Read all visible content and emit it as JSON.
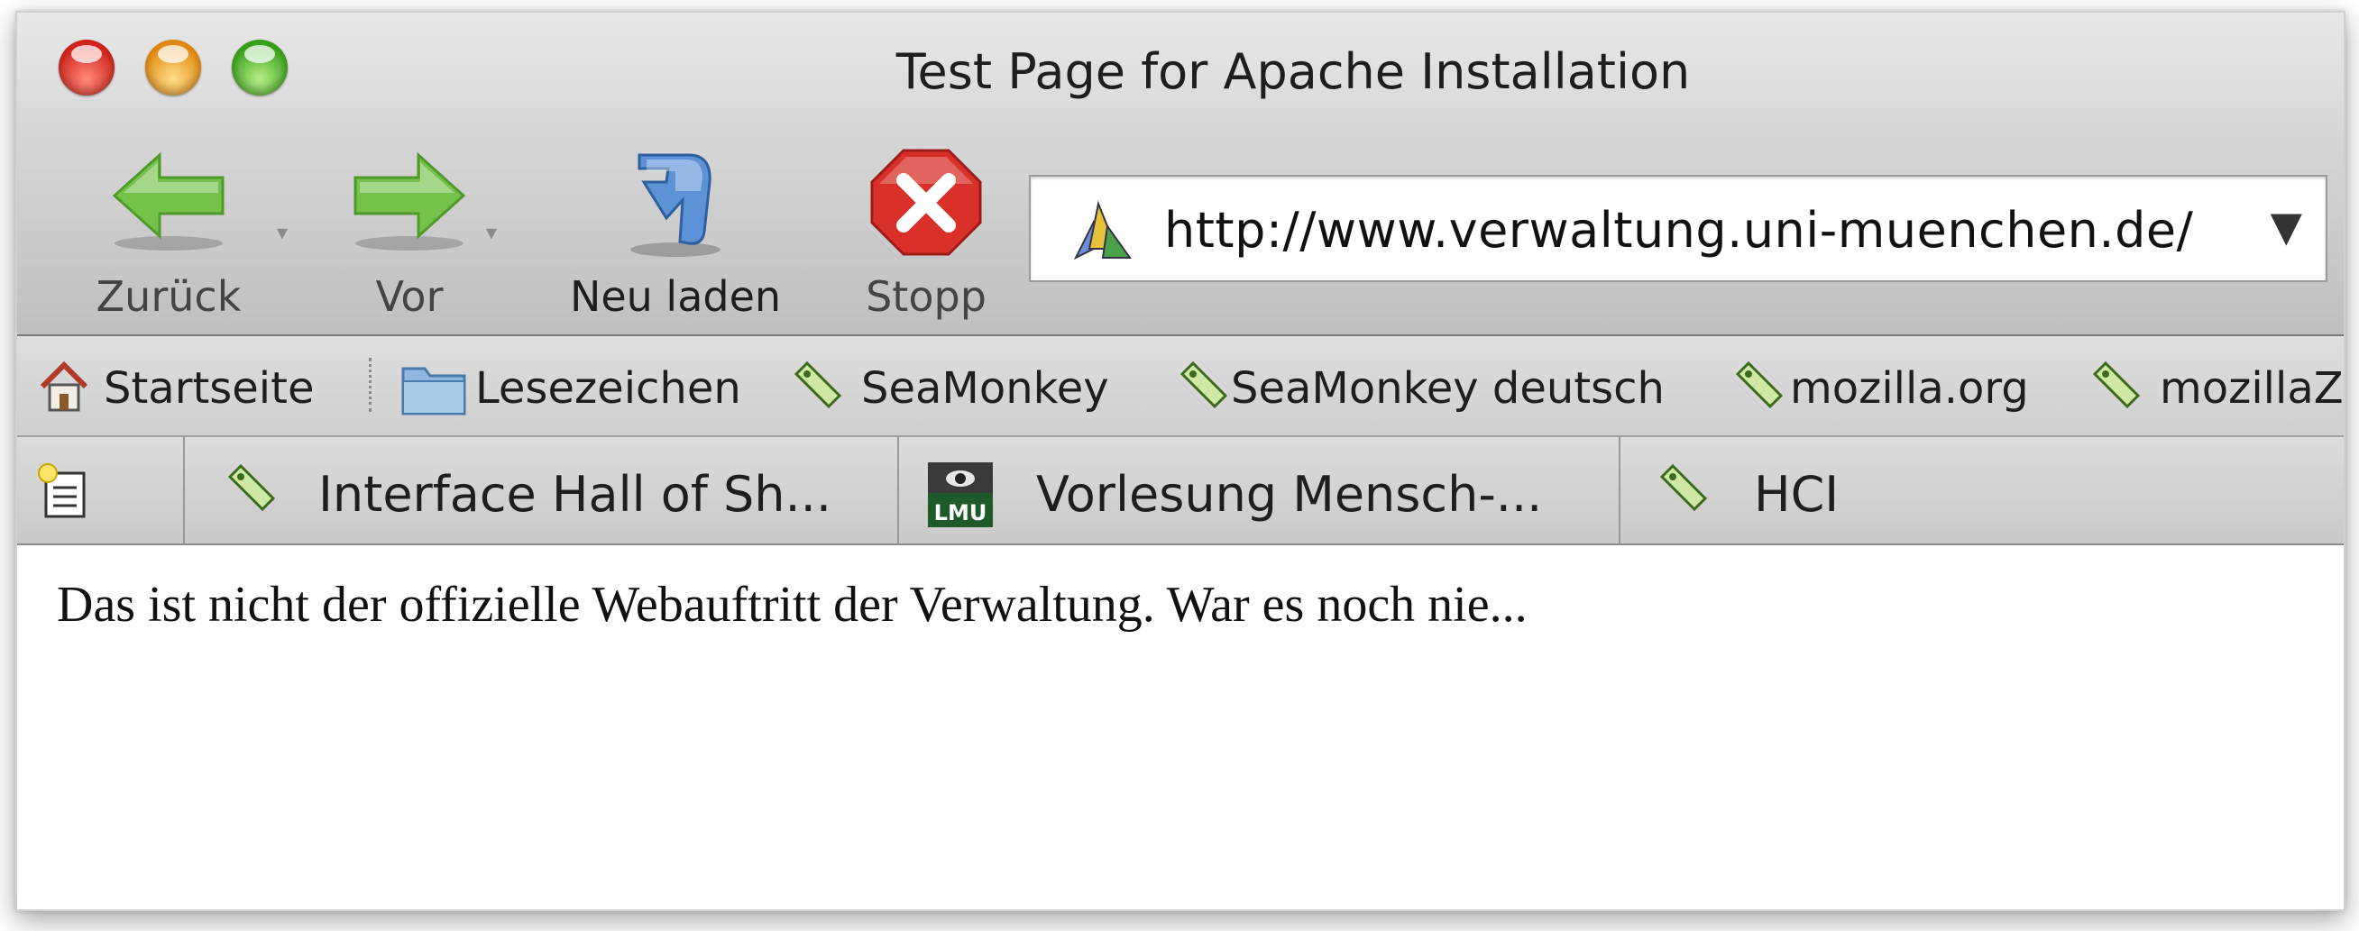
{
  "window": {
    "title": "Test Page for Apache Installation"
  },
  "toolbar": {
    "back_label": "Zurück",
    "forward_label": "Vor",
    "reload_label": "Neu laden",
    "stop_label": "Stopp"
  },
  "urlbar": {
    "url": "http://www.verwaltung.uni-muenchen.de/"
  },
  "bookmarks": {
    "items": [
      {
        "label": "Startseite",
        "icon": "home-icon"
      },
      {
        "label": "Lesezeichen",
        "icon": "folder-icon"
      },
      {
        "label": "SeaMonkey",
        "icon": "bookmark-icon"
      },
      {
        "label": "SeaMonkey deutsch",
        "icon": "bookmark-icon"
      },
      {
        "label": "mozilla.org",
        "icon": "bookmark-icon"
      },
      {
        "label": "mozillaZ",
        "icon": "bookmark-icon"
      }
    ]
  },
  "tabs": {
    "items": [
      {
        "label": "Interface Hall of Sh...",
        "icon": "bookmark-icon"
      },
      {
        "label": "Vorlesung Mensch-...",
        "icon": "lmu-logo-icon"
      },
      {
        "label": "HCI",
        "icon": "bookmark-icon"
      }
    ]
  },
  "page": {
    "text": "Das ist nicht der offizielle Webauftritt der Verwaltung. War es noch nie..."
  },
  "colors": {
    "arrow_green": "#74c24a",
    "stop_red": "#d9302a",
    "reload_blue": "#5d93d6"
  }
}
